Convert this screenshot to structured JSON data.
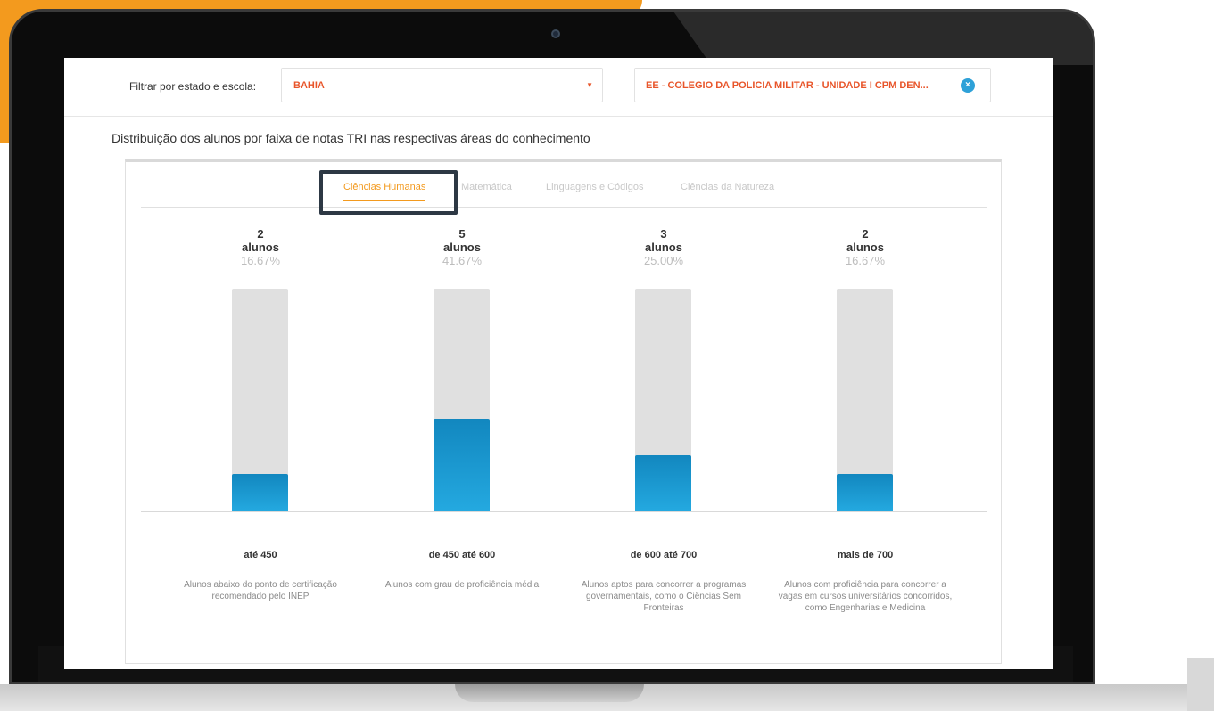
{
  "filter": {
    "label": "Filtrar por estado e escola:",
    "state_value": "BAHIA",
    "state_arrow": "▼",
    "school_value": "EE - COLEGIO DA POLICIA MILITAR - UNIDADE I CPM DEN...",
    "clear_glyph": "×"
  },
  "section_title": "Distribuição dos alunos por faixa de notas TRI nas respectivas áreas do conhecimento",
  "tabs": [
    {
      "label": "Ciências Humanas",
      "active": true
    },
    {
      "label": "Matemática",
      "active": false
    },
    {
      "label": "Linguagens e Códigos",
      "active": false
    },
    {
      "label": "Ciências da Natureza",
      "active": false
    }
  ],
  "colors": {
    "accent": "#f39a1e",
    "bar": "#1d98d3",
    "track": "#e0e0e0",
    "select_text": "#e8552a"
  },
  "chart_data": {
    "type": "bar",
    "categories": [
      "até 450",
      "de 450 até 600",
      "de 600 até 700",
      "mais de 700"
    ],
    "values": [
      2,
      5,
      3,
      2
    ],
    "unit": "alunos",
    "percentages": [
      "16.67%",
      "41.67%",
      "25.00%",
      "16.67%"
    ],
    "descriptions": [
      "Alunos abaixo do ponto de certificação recomendado pelo INEP",
      "Alunos com grau de proficiência média",
      "Alunos aptos para concorrer a programas governamentais, como o Ciências Sem Fronteiras",
      "Alunos com proficiência para concorrer a vagas em cursos universitários concorridos, como Engenharias e Medicina"
    ],
    "ylim": [
      0,
      12
    ]
  }
}
